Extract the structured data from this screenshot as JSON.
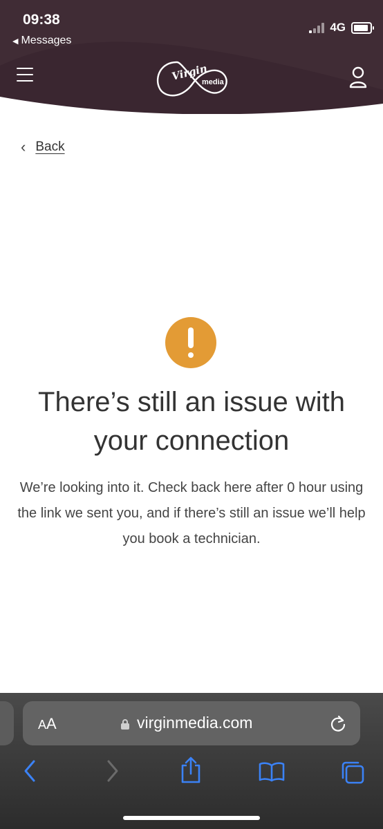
{
  "status_bar": {
    "time": "09:38",
    "back_app": "Messages",
    "network": "4G"
  },
  "header": {
    "logo_text_virgin": "Virgin",
    "logo_text_media": "media",
    "menu_icon": "hamburger-icon",
    "account_icon": "user-icon"
  },
  "page": {
    "back_label": "Back",
    "headline": "There’s still an issue with your connection",
    "body": "We’re looking into it. Check back here after 0 hour using the link we sent you, and if there’s still an issue we’ll help you book a technician.",
    "status_icon": "warning-icon",
    "status_color": "#e39b35"
  },
  "browser": {
    "aa_label_small": "A",
    "aa_label_big": "A",
    "url": "virginmedia.com",
    "accent": "#3b82f6"
  },
  "colors": {
    "brand_dark": "#3a2630",
    "text": "#333333"
  }
}
